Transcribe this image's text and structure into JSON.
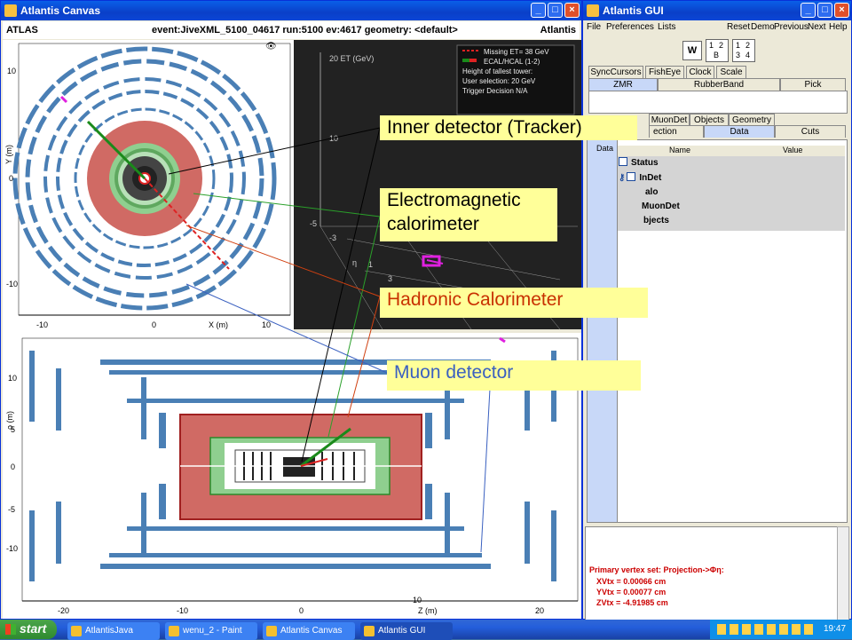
{
  "canvas_window": {
    "title": "Atlantis Canvas",
    "header_left": "ATLAS",
    "header_center": "event:JiveXML_5100_04617 run:5100 ev:4617 geometry: <default>",
    "header_right": "Atlantis",
    "xy_view": {
      "y_axis_label": "Y (m)",
      "x_axis_label": "X (m)",
      "x_ticks": [
        "-10",
        "0",
        "10"
      ],
      "y_ticks": [
        "10",
        "0",
        "-10"
      ]
    },
    "lego_view": {
      "axis_label": "20 ET (GeV)",
      "ticks": [
        "10",
        "-5",
        "-3",
        "1",
        "3"
      ],
      "eta_label": "η",
      "legend": {
        "line1": "Missing ET= 38 GeV",
        "line2": "ECAL/HCAL (1-2)",
        "line3": "Height of tallest tower:",
        "line4": "User selection: 20 GeV",
        "line5": "Trigger Decision N/A"
      }
    },
    "rz_view": {
      "y_axis_label": "ρ (m)",
      "x_axis_label": "Z (m)",
      "x_ticks": [
        "-20",
        "-10",
        "0",
        "10",
        "20"
      ],
      "y_ticks": [
        "10",
        "5",
        "0",
        "-5",
        "-10"
      ]
    }
  },
  "gui_window": {
    "title": "Atlantis GUI",
    "menu": [
      "File",
      "Preferences",
      "Lists"
    ],
    "menu_right": [
      "Reset",
      "Demo",
      "Previous",
      "Next",
      "Help"
    ],
    "window_buttons": {
      "w": "W",
      "b1": "1",
      "b2": "2",
      "b_b": "B",
      "b3": "3",
      "b4": "4",
      "c1": "1",
      "c2": "2",
      "c3": "3",
      "c4": "4"
    },
    "tabs_row1": [
      "SyncCursors",
      "FishEye",
      "Clock",
      "Scale"
    ],
    "tabs_row2": [
      "ZMR",
      "RubberBand",
      "Pick"
    ],
    "tabs_row3": [
      "MuonDet",
      "Objects",
      "Geometry"
    ],
    "tabs_row4": [
      "ection",
      "Data",
      "Cuts"
    ],
    "side_tab": "Data",
    "table_headers": [
      "Name",
      "Value"
    ],
    "tree": [
      "Status",
      "InDet",
      "alo",
      "MuonDet",
      "bjects"
    ],
    "output": {
      "line1": "Primary vertex set: Projection->Φη:",
      "line2": "XVtx = 0.00066 cm",
      "line3": "YVtx = 0.00077 cm",
      "line4": "ZVtx = -4.91985 cm"
    }
  },
  "callouts": {
    "inner": "Inner detector (Tracker)",
    "em": "Electromagnetic calorimeter",
    "had": "Hadronic Calorimeter",
    "muon": "Muon detector"
  },
  "taskbar": {
    "start": "start",
    "items": [
      "AtlantisJava",
      "wenu_2 - Paint",
      "Atlantis Canvas",
      "Atlantis GUI"
    ],
    "clock": "19:47"
  },
  "colors": {
    "hadronic": "#d06a64",
    "em": "#8fcf8f",
    "muon": "#4a7fb5",
    "callout_bg": "#ffff99",
    "output_text": "#cc0000"
  }
}
